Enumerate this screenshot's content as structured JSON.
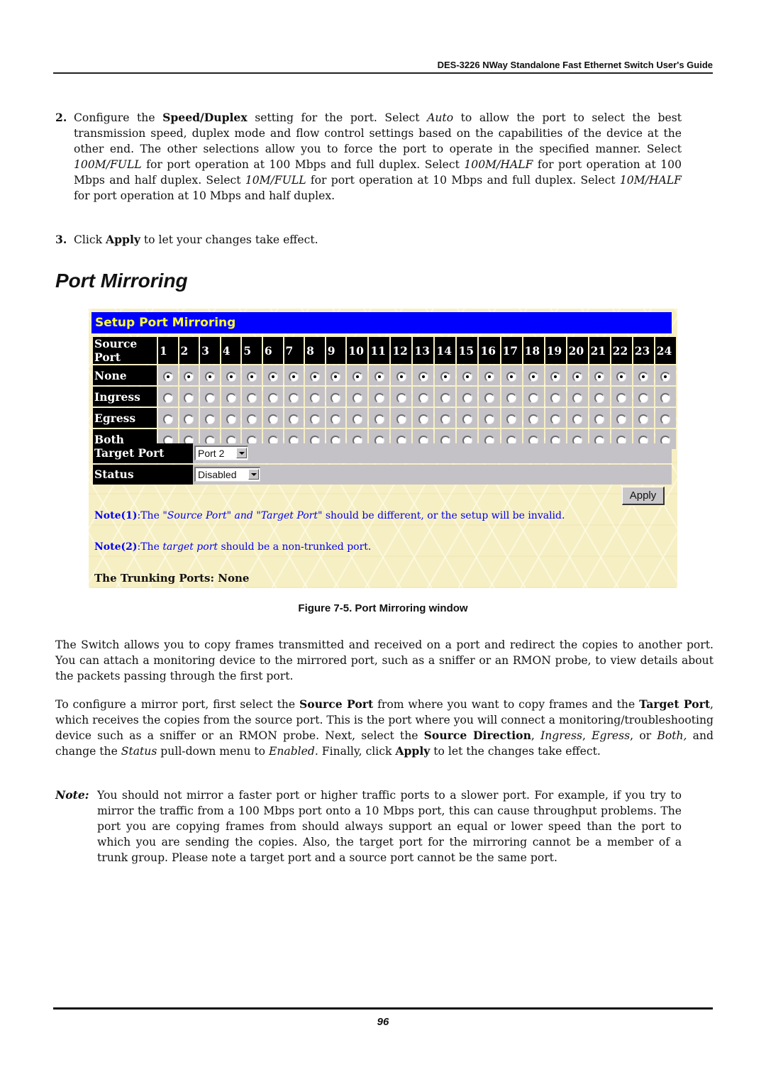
{
  "header": {
    "title": "DES-3226 NWay Standalone Fast Ethernet Switch User's Guide"
  },
  "steps": [
    {
      "number": "2.",
      "segments": [
        {
          "t": "Configure the "
        },
        {
          "t": "Speed/Duplex",
          "b": true
        },
        {
          "t": " setting for the port. Select "
        },
        {
          "t": "Auto",
          "i": true
        },
        {
          "t": " to allow the port to select the best transmission speed, duplex mode and flow control settings based on the capabilities of the device at the other end. The other selections allow you to force the port to operate in the specified manner. Select "
        },
        {
          "t": "100M/FULL",
          "i": true
        },
        {
          "t": " for port operation at 100 Mbps and full duplex. Select "
        },
        {
          "t": "100M/HALF",
          "i": true
        },
        {
          "t": " for port operation at 100 Mbps and half duplex. Select "
        },
        {
          "t": "10M/FULL",
          "i": true
        },
        {
          "t": " for port operation at 10 Mbps and full duplex. Select "
        },
        {
          "t": "10M/HALF",
          "i": true
        },
        {
          "t": " for port operation at 10 Mbps and half duplex."
        }
      ]
    },
    {
      "number": "3.",
      "segments": [
        {
          "t": "Click "
        },
        {
          "t": "Apply",
          "b": true
        },
        {
          "t": " to let your changes take effect."
        }
      ]
    }
  ],
  "section_title": "Port Mirroring",
  "panel": {
    "title": "Setup Port Mirroring",
    "colors": {
      "title_bg": "#0000ff",
      "title_fg": "#ffff33",
      "note_fg": "#0000ee",
      "panel_bg": "#f7efc4",
      "cell_bg": "#c4c2c6"
    },
    "source_port_label": "Source Port",
    "ports": [
      "1",
      "2",
      "3",
      "4",
      "5",
      "6",
      "7",
      "8",
      "9",
      "10",
      "11",
      "12",
      "13",
      "14",
      "15",
      "16",
      "17",
      "18",
      "19",
      "20",
      "21",
      "22",
      "23",
      "24"
    ],
    "directions": [
      {
        "label": "None",
        "selected_ports": [
          "1",
          "2",
          "3",
          "4",
          "5",
          "6",
          "7",
          "8",
          "9",
          "10",
          "11",
          "12",
          "13",
          "14",
          "15",
          "16",
          "17",
          "18",
          "19",
          "20",
          "21",
          "22",
          "23",
          "24"
        ]
      },
      {
        "label": "Ingress",
        "selected_ports": []
      },
      {
        "label": "Egress",
        "selected_ports": []
      },
      {
        "label": "Both",
        "selected_ports": []
      }
    ],
    "target_port": {
      "label": "Target Port",
      "value": "Port 2"
    },
    "status": {
      "label": "Status",
      "value": "Disabled"
    },
    "apply_label": "Apply",
    "note1": {
      "label": "Note(1)",
      "pre": ":The ",
      "emph": "\"Source Port\" and \"Target Port\"",
      "post": " should be different, or the setup will be invalid."
    },
    "note2": {
      "label": "Note(2)",
      "pre": ":The ",
      "emph": "target port",
      "post": " should be a non-trunked port."
    },
    "trunking": "The Trunking Ports: None"
  },
  "caption": "Figure 7-5.  Port Mirroring window",
  "paragraphs": [
    {
      "segments": [
        {
          "t": "The Switch allows you to copy frames transmitted and received on a port and redirect the copies to another port. You can attach a monitoring device to the mirrored port, such as a sniffer or an RMON probe, to view details about the packets passing through the first port."
        }
      ]
    },
    {
      "segments": [
        {
          "t": "To configure a mirror port, first select the "
        },
        {
          "t": "Source Port",
          "b": true
        },
        {
          "t": " from where you want to copy frames and the "
        },
        {
          "t": "Target Port",
          "b": true
        },
        {
          "t": ", which receives the copies from the source port. This is the port where you will connect a monitoring/troubleshooting device such as a sniffer or an RMON probe. Next, select the "
        },
        {
          "t": "Source Direction",
          "b": true
        },
        {
          "t": ", "
        },
        {
          "t": "Ingress",
          "i": true
        },
        {
          "t": ", "
        },
        {
          "t": "Egress",
          "i": true
        },
        {
          "t": ", or "
        },
        {
          "t": "Both,",
          "i": true
        },
        {
          "t": " and change the "
        },
        {
          "t": "Status",
          "i": true
        },
        {
          "t": " pull-down menu to "
        },
        {
          "t": "Enabled.",
          "i": true
        },
        {
          "t": " Finally, click "
        },
        {
          "t": "Apply",
          "b": true
        },
        {
          "t": " to let the changes take effect."
        }
      ]
    }
  ],
  "note": {
    "label": "Note:",
    "text": "You should not mirror a faster port or higher traffic ports to a slower port. For example, if you try to mirror the traffic from a 100 Mbps port onto a 10 Mbps port, this can cause throughput problems. The port you are copying frames from should always support an equal or lower speed than the port to which you are sending the copies. Also, the target port for the mirroring cannot be a member of a trunk group. Please note a target port and a source port cannot be the same port."
  },
  "page_number": "96"
}
